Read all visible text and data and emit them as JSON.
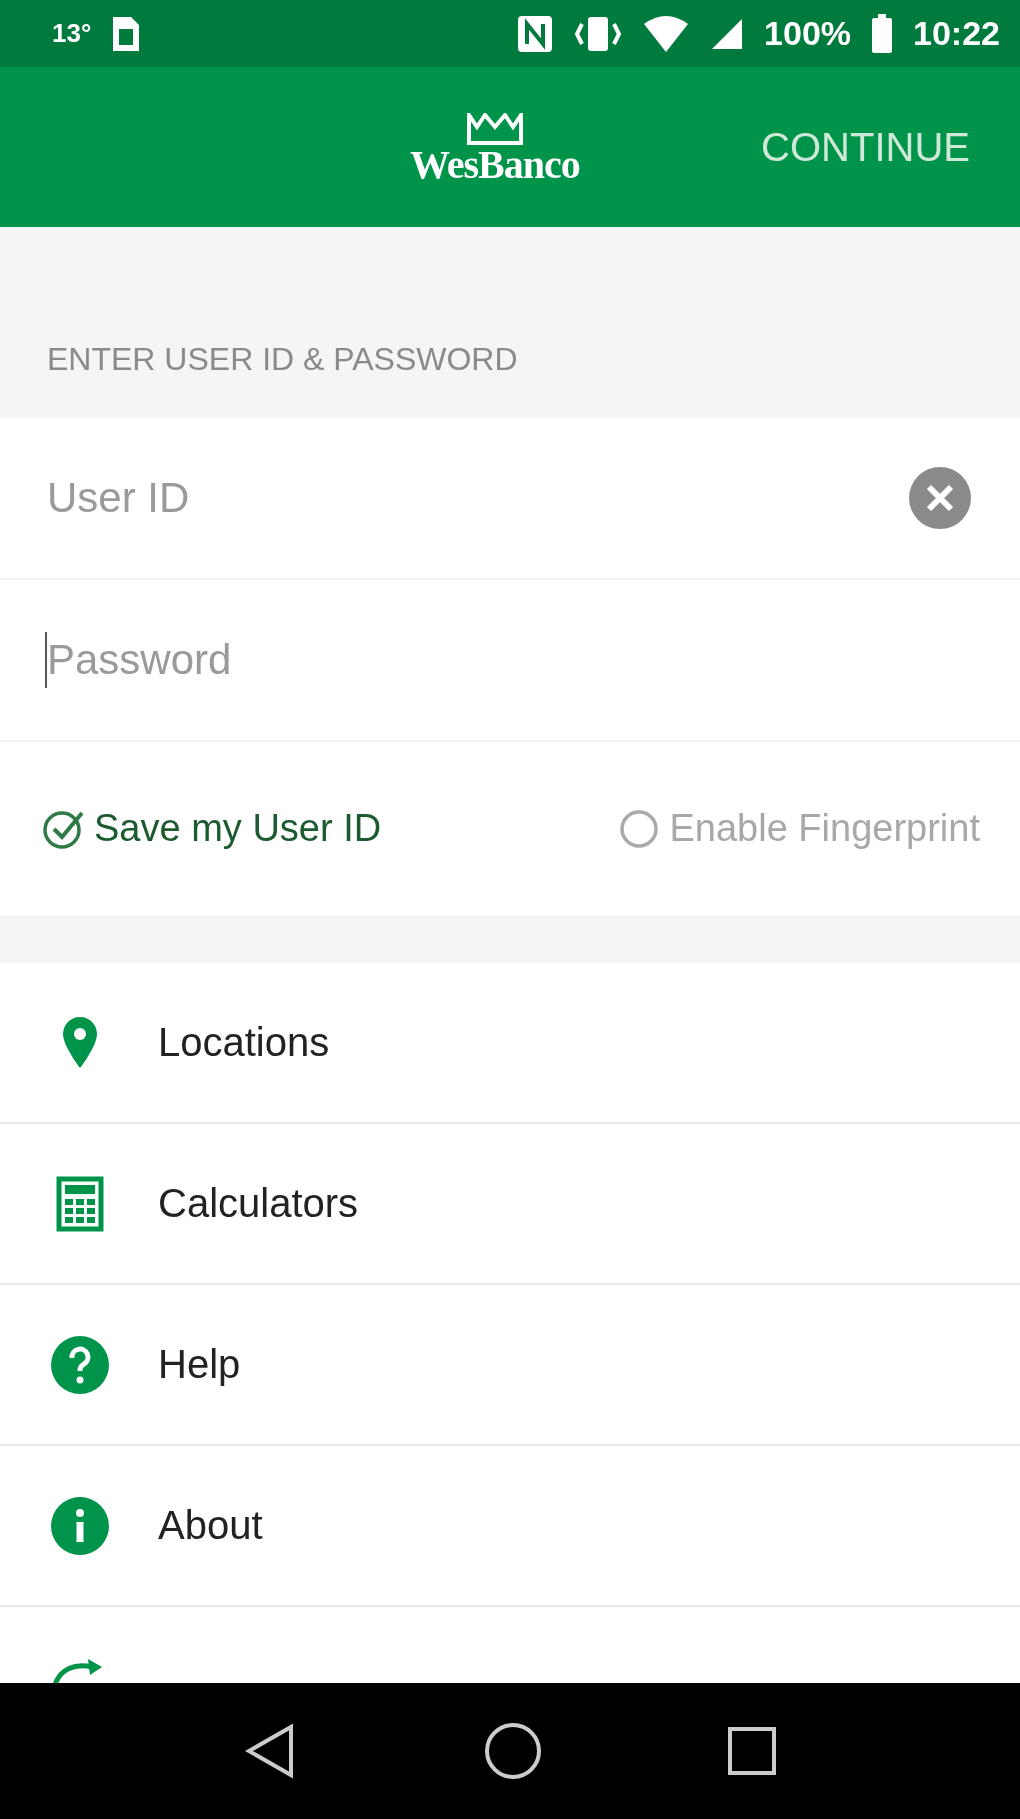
{
  "status_bar": {
    "temperature": "13°",
    "battery": "100%",
    "time": "10:22"
  },
  "app_bar": {
    "logo": "WesBanco",
    "action": "CONTINUE"
  },
  "login": {
    "header": "ENTER USER ID & PASSWORD",
    "fields": [
      {
        "placeholder": "User ID",
        "clearable": true,
        "focused": false
      },
      {
        "placeholder": "Password",
        "clearable": false,
        "focused": true
      }
    ],
    "options": [
      {
        "label": "Save my User ID",
        "checked": true
      },
      {
        "label": "Enable Fingerprint",
        "checked": false
      }
    ]
  },
  "menu": [
    {
      "kind": "locations",
      "label": "Locations"
    },
    {
      "kind": "calculators",
      "label": "Calculators"
    },
    {
      "kind": "help",
      "label": "Help"
    },
    {
      "kind": "about",
      "label": "About"
    },
    {
      "kind": "reset"
    }
  ]
}
